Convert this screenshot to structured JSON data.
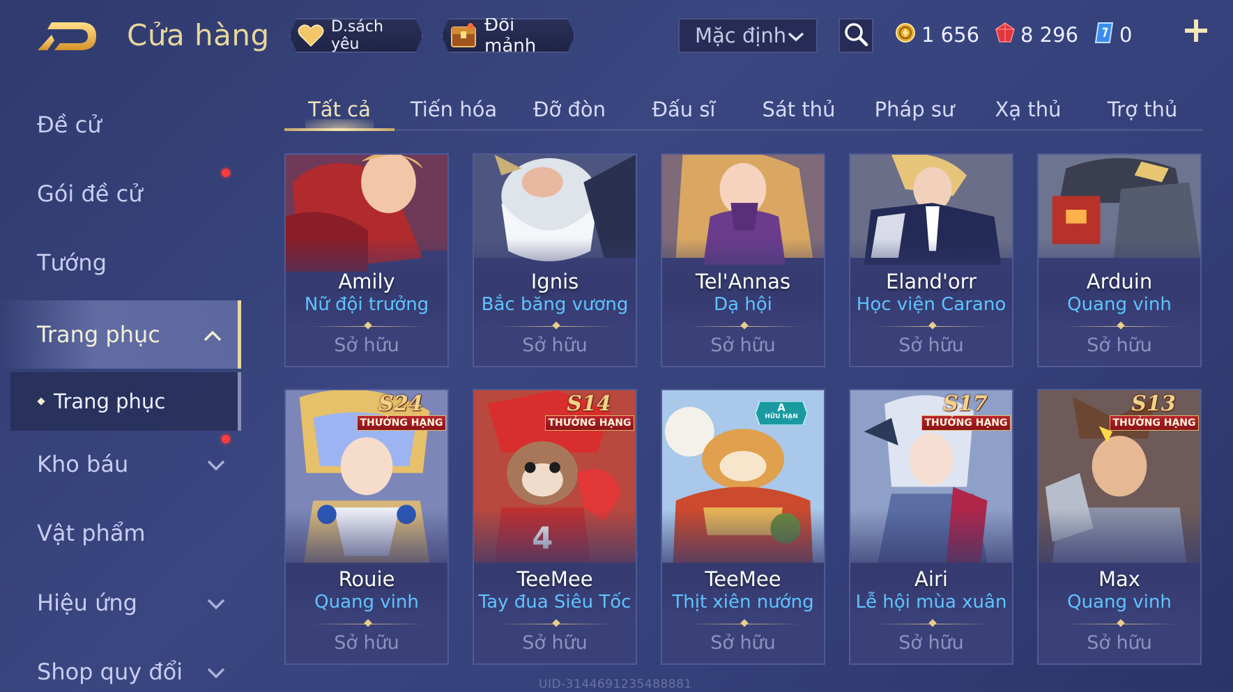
{
  "header": {
    "title": "Cửa hàng",
    "favorites_label": "D.sách yêu",
    "fragments_label": "Đổi mảnh",
    "sort": {
      "selected": "Mặc định"
    },
    "currencies": {
      "gold": "1 656",
      "gems": "8 296",
      "vouchers": "0"
    }
  },
  "sidebar": {
    "items": [
      {
        "label": "Đề cử"
      },
      {
        "label": "Gói đề cử"
      },
      {
        "label": "Tướng"
      },
      {
        "label": "Trang phục"
      },
      {
        "label": "Trang phục"
      },
      {
        "label": "Kho báu"
      },
      {
        "label": "Vật phẩm"
      },
      {
        "label": "Hiệu ứng"
      },
      {
        "label": "Shop quy đổi"
      }
    ]
  },
  "tabs": [
    {
      "label": "Tất cả"
    },
    {
      "label": "Tiến hóa"
    },
    {
      "label": "Đỡ đòn"
    },
    {
      "label": "Đấu sĩ"
    },
    {
      "label": "Sát thủ"
    },
    {
      "label": "Pháp sư"
    },
    {
      "label": "Xạ thủ"
    },
    {
      "label": "Trợ thủ"
    }
  ],
  "cards": [
    {
      "hero": "Amily",
      "skin": "Nữ đội trưởng",
      "status": "Sở hữu"
    },
    {
      "hero": "Ignis",
      "skin": "Bắc băng vương",
      "status": "Sở hữu"
    },
    {
      "hero": "Tel'Annas",
      "skin": "Dạ hội",
      "status": "Sở hữu"
    },
    {
      "hero": "Eland'orr",
      "skin": "Học viện Carano",
      "status": "Sở hữu"
    },
    {
      "hero": "Arduin",
      "skin": "Quang vinh",
      "status": "Sở hữu"
    },
    {
      "hero": "Rouie",
      "skin": "Quang vinh",
      "status": "Sở hữu",
      "season": "S24",
      "badge": "THƯỞNG HẠNG"
    },
    {
      "hero": "TeeMee",
      "skin": "Tay đua Siêu Tốc",
      "status": "Sở hữu",
      "season": "S14",
      "badge": "THƯỞNG HẠNG"
    },
    {
      "hero": "TeeMee",
      "skin": "Thịt xiên nướng",
      "status": "Sở hữu",
      "limited_a": "A",
      "limited": "HỮU HẠN"
    },
    {
      "hero": "Airi",
      "skin": "Lễ hội mùa xuân",
      "status": "Sở hữu",
      "season": "S17",
      "badge": "THƯỞNG HẠNG"
    },
    {
      "hero": "Max",
      "skin": "Quang vinh",
      "status": "Sở hữu",
      "season": "S13",
      "badge": "THƯỞNG HẠNG"
    }
  ],
  "uid_text": "UID-3144691235488881",
  "colors": {
    "accent_gold": "#e9d79c",
    "skin_blue": "#5fc3ff",
    "notify_red": "#ff3b3b",
    "rank_red": "#b9232a"
  }
}
